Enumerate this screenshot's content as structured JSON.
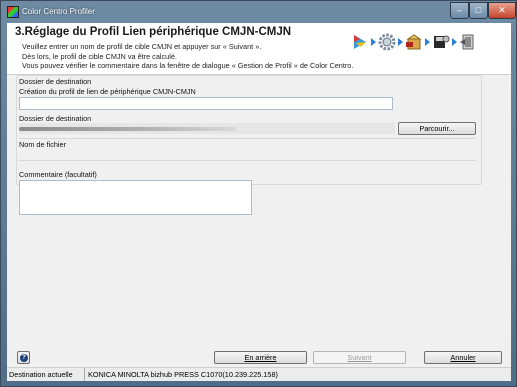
{
  "window": {
    "title": "Color Centro Profiler",
    "controls": [
      "minimize",
      "maximize",
      "close"
    ]
  },
  "header": {
    "step_title": "3.Réglage du Profil Lien périphérique CMJN-CMJN",
    "description": [
      "Veuillez entrer un nom de profil de cible CMJN et appuyer sur « Suivant ».",
      "Dès lors, le profil de cible CMJN va être calculé.",
      "Vous pouvez vérifier le commentaire dans la fenêtre de dialogue « Gestion de Profil » de Color Centro."
    ],
    "wizard_icons": [
      "play-icon",
      "gear-icon",
      "package-icon",
      "save-icon",
      "exit-icon"
    ]
  },
  "destination_group": {
    "title": "Dossier de destination",
    "name_label": "Création du profil de lien de périphérique CMJN-CMJN",
    "name_value": "",
    "folder_label": "Dossier de destination",
    "browse_button": "Parcourir...",
    "file_label": "Nom de fichier",
    "file_value": ""
  },
  "comment": {
    "label": "Commentaire (facultatif)",
    "value": ""
  },
  "footer": {
    "help_icon": "question-icon",
    "back_button": "En arrière",
    "next_button": "Suivant",
    "cancel_button": "Annuler"
  },
  "status_bar": {
    "label": "Destination actuelle",
    "value": "KONICA MINOLTA bizhub PRESS C1070(10.239.225.158)"
  }
}
